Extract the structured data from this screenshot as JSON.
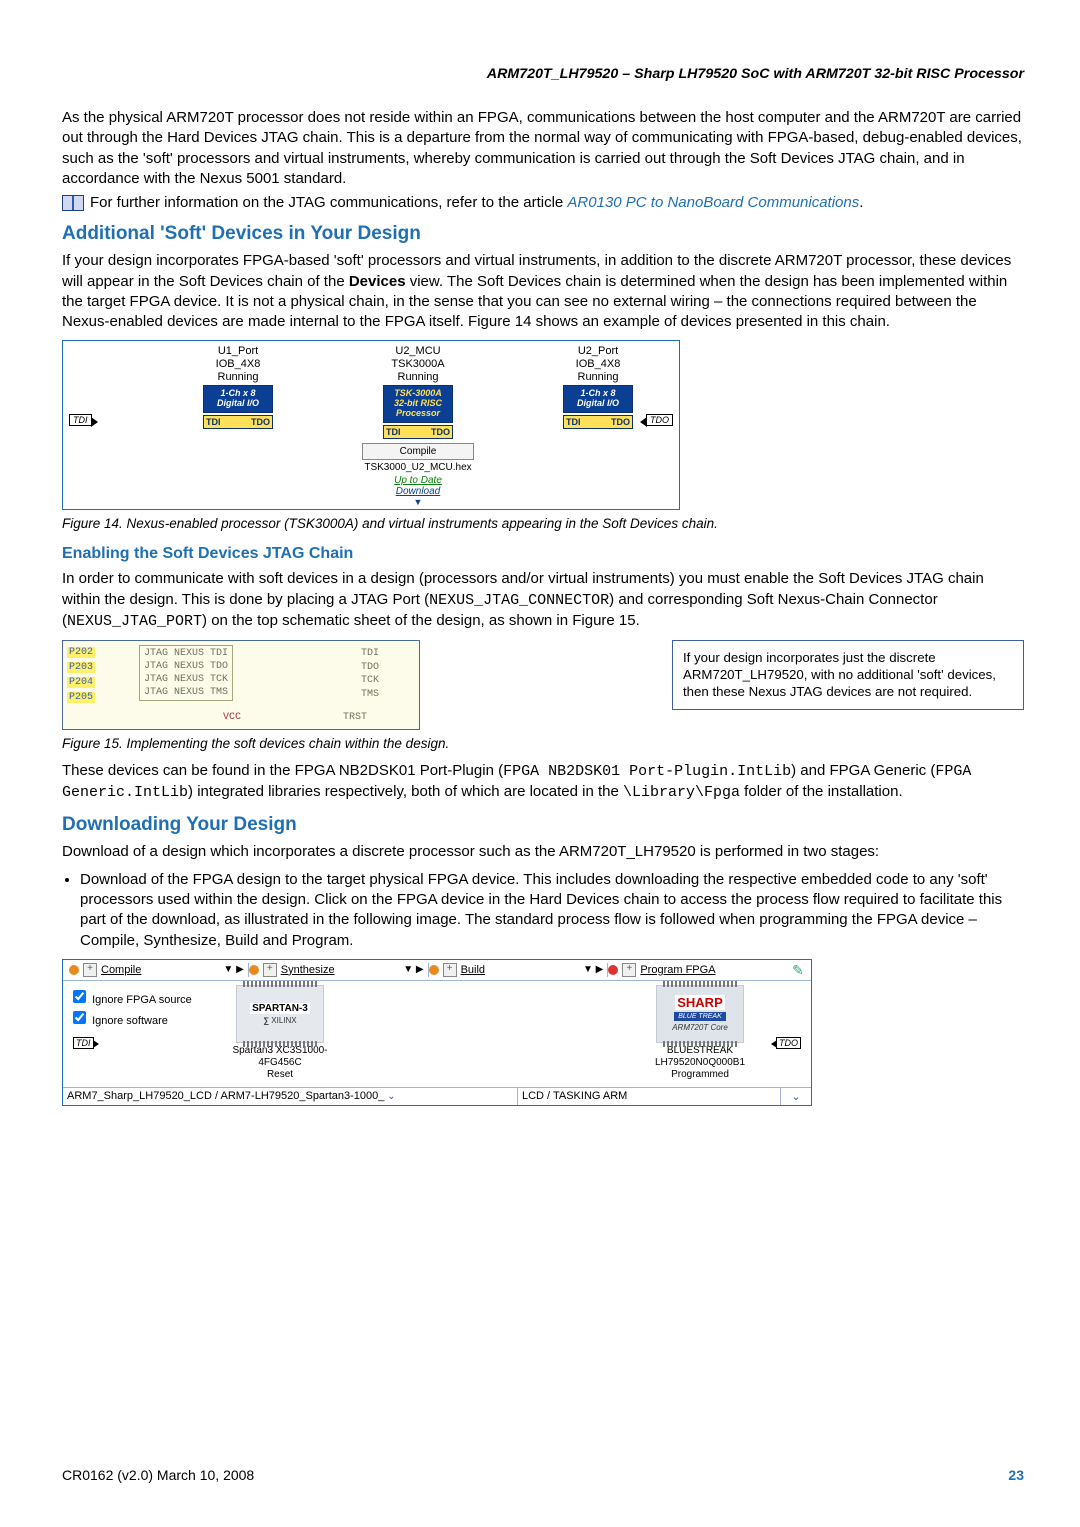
{
  "header": {
    "title": "ARM720T_LH79520 – Sharp LH79520 SoC with ARM720T 32-bit RISC Processor"
  },
  "para": {
    "p1": "As the physical ARM720T processor does not reside within an FPGA, communications between the host computer and the ARM720T are carried out through the Hard Devices JTAG chain. This is a departure from the normal way of communicating with FPGA-based, debug-enabled devices, such as the 'soft' processors and virtual instruments, whereby communication is carried out through the Soft Devices JTAG chain, and in accordance with the Nexus 5001 standard.",
    "p2_pre": "For further information on the JTAG communications, refer to the article ",
    "p2_link": "AR0130 PC to NanoBoard Communications",
    "p2_post": "."
  },
  "h_soft": "Additional 'Soft' Devices in Your Design",
  "para2": {
    "a": "If your design incorporates FPGA-based 'soft' processors and virtual instruments, in addition to the discrete ARM720T processor, these devices will appear in the Soft Devices chain of the ",
    "b": "Devices",
    "c": " view. The Soft Devices chain is determined when the design has been implemented within the target FPGA device. It is not a physical chain, in the sense that you can see no external wiring – the connections required between the Nexus-enabled devices are made internal to the FPGA itself. Figure 14 shows an example of devices presented in this chain."
  },
  "fig14": {
    "tdi": "TDI",
    "tdo": "TDO",
    "d1": {
      "l1": "U1_Port",
      "l2": "IOB_4X8",
      "l3": "Running",
      "chip1": "1-Ch x 8",
      "chip2": "Digital I/O",
      "ti": "TDI",
      "to": "TDO"
    },
    "d2": {
      "l1": "U2_MCU",
      "l2": "TSK3000A",
      "l3": "Running",
      "chip1": "TSK-3000A",
      "chip2": "32-bit RISC",
      "chip3": "Processor",
      "ti": "TDI",
      "to": "TDO",
      "compile": "Compile",
      "hex": "TSK3000_U2_MCU.hex",
      "upd": "Up to Date",
      "dl": "Download"
    },
    "d3": {
      "l1": "U2_Port",
      "l2": "IOB_4X8",
      "l3": "Running",
      "chip1": "1-Ch x 8",
      "chip2": "Digital I/O",
      "ti": "TDI",
      "to": "TDO"
    }
  },
  "cap14": "Figure 14. Nexus-enabled processor (TSK3000A) and virtual instruments appearing in the Soft Devices chain.",
  "h_enable": "Enabling the Soft Devices JTAG Chain",
  "para3": {
    "a": "In order to communicate with soft devices in a design (processors and/or virtual instruments) you must enable the Soft Devices JTAG chain within the design. This is done by placing a JTAG Port (",
    "b": "NEXUS_JTAG_CONNECTOR",
    "c": ") and corresponding Soft Nexus-Chain Connector (",
    "d": "NEXUS_JTAG_PORT",
    "e": ") on the top schematic sheet of the design, as shown in Figure 15."
  },
  "fig15": {
    "ports": [
      "P202",
      "P203",
      "P204",
      "P205"
    ],
    "wires": [
      "JTAG NEXUS TDI",
      "JTAG NEXUS TDO",
      "JTAG NEXUS TCK",
      "JTAG NEXUS TMS"
    ],
    "rhs": [
      "TDI",
      "TDO",
      "TCK",
      "TMS"
    ],
    "vcc": "VCC",
    "trst": "TRST"
  },
  "note": "If your design incorporates just the discrete ARM720T_LH79520, with no additional 'soft' devices, then these Nexus JTAG devices are not required.",
  "cap15": "Figure 15. Implementing the soft devices chain within the design.",
  "para4": {
    "a": "These devices can be found in the FPGA NB2DSK01 Port-Plugin (",
    "b": "FPGA NB2DSK01 Port-Plugin.IntLib",
    "c": ") and FPGA Generic (",
    "d": "FPGA Generic.IntLib",
    "e": ") integrated libraries respectively, both of which are located in the ",
    "f": "\\Library\\Fpga",
    "g": " folder of the installation."
  },
  "h_download": "Downloading Your Design",
  "para5": "Download of a design which incorporates a discrete processor such as the ARM720T_LH79520 is performed in two stages:",
  "bullet1": "Download of the FPGA design to the target physical FPGA device. This includes downloading the respective embedded code to any 'soft' processors used within the design. Click on the FPGA device in the Hard Devices chain to access the process flow required to facilitate this part of the download, as illustrated in the following image. The standard process flow is followed when programming the FPGA device – Compile, Synthesize, Build and Program.",
  "fig16": {
    "stages": [
      "Compile",
      "Synthesize",
      "Build",
      "Program FPGA"
    ],
    "checks": [
      "Ignore FPGA source",
      "Ignore software"
    ],
    "tdi": "TDI",
    "tdo": "TDO",
    "card1": {
      "brand": "SPARTAN-3",
      "sub": "XILINX",
      "label": "Spartan3 XC3S1000-4FG456C",
      "status": "Reset"
    },
    "card2": {
      "brand": "SHARP",
      "bs": "BLUE   TREAK",
      "core": "ARM720T Core",
      "label": "BLUESTREAK LH79520N0Q000B1",
      "status": "Programmed"
    },
    "row1": "ARM7_Sharp_LH79520_LCD / ARM7-LH79520_Spartan3-1000_",
    "row2": "LCD / TASKING ARM"
  },
  "footer": {
    "left": "CR0162 (v2.0) March 10, 2008",
    "page": "23"
  }
}
